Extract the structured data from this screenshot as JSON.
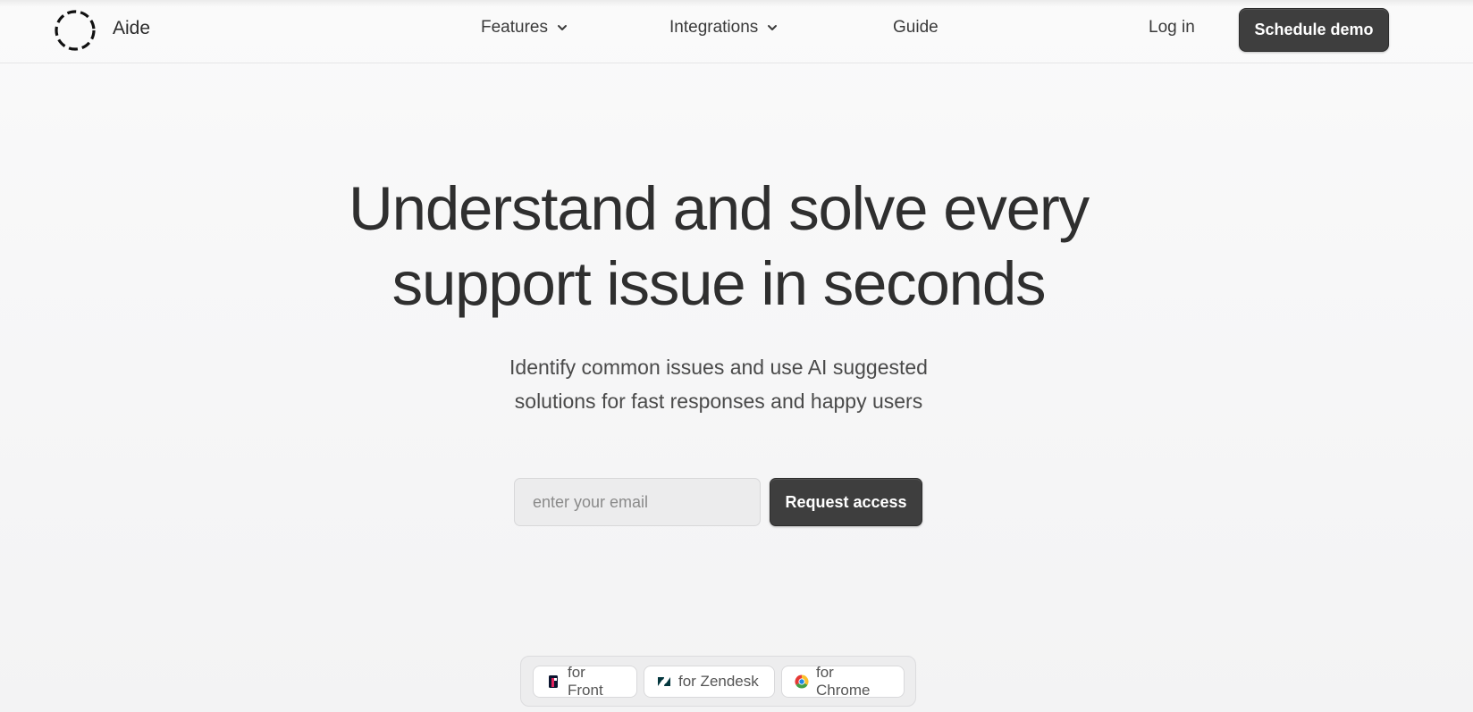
{
  "brand": {
    "name": "Aide",
    "logo_icon": "dashed-circle-icon"
  },
  "nav": {
    "features": "Features",
    "integrations": "Integrations",
    "guide": "Guide",
    "login": "Log in",
    "demo_button": "Schedule demo"
  },
  "hero": {
    "headline_line1": "Understand and solve every",
    "headline_line2": "support issue in seconds",
    "subline_line1": "Identify common issues and use AI suggested",
    "subline_line2": "solutions for fast responses and happy users"
  },
  "form": {
    "email_placeholder": "enter your email",
    "email_value": "",
    "submit_label": "Request access"
  },
  "integrations": [
    {
      "label": "for Front",
      "icon": "front-icon"
    },
    {
      "label": "for Zendesk",
      "icon": "zendesk-icon"
    },
    {
      "label": "for Chrome",
      "icon": "chrome-icon"
    }
  ],
  "colors": {
    "primary_button": "#3e3e3e",
    "text": "#2f2f2f",
    "background": "#f7f7f8"
  }
}
